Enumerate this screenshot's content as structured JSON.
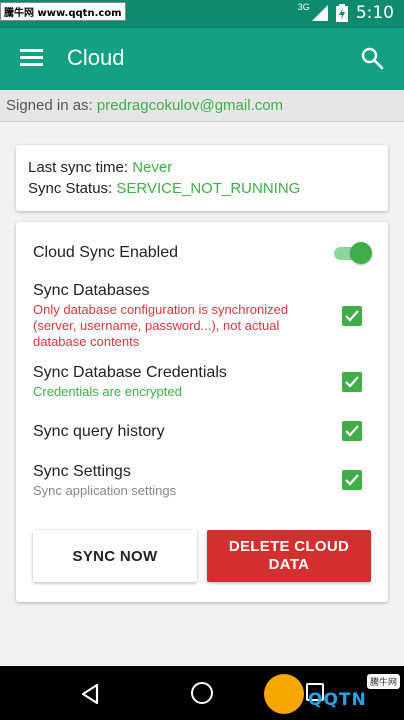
{
  "status_bar": {
    "watermark": "騰牛网 www.qqtn.com",
    "network": "3G",
    "time": "5:10"
  },
  "app_bar": {
    "title": "Cloud"
  },
  "account": {
    "label": "Signed in as:",
    "email": "predragcokulov@gmail.com"
  },
  "sync_info": {
    "last_sync_label": "Last sync time:",
    "last_sync_value": "Never",
    "status_label": "Sync Status:",
    "status_value": "SERVICE_NOT_RUNNING"
  },
  "settings": {
    "cloud_sync": {
      "title": "Cloud Sync Enabled",
      "enabled": true
    },
    "sync_databases": {
      "title": "Sync Databases",
      "subtitle": "Only database configuration is synchronized (server, username, password...), not actual database contents",
      "checked": true
    },
    "sync_credentials": {
      "title": "Sync Database Credentials",
      "subtitle": "Credentials are encrypted",
      "checked": true
    },
    "sync_query_history": {
      "title": "Sync query history",
      "checked": true
    },
    "sync_settings": {
      "title": "Sync Settings",
      "subtitle": "Sync application settings",
      "checked": true
    }
  },
  "buttons": {
    "sync_now": "SYNC NOW",
    "delete_cloud_data": "DELETE CLOUD DATA"
  },
  "nav_watermark": {
    "brand": "QQTN",
    "tag": "騰牛网"
  },
  "colors": {
    "primary": "#12a182",
    "primary_dark": "#0e8b6f",
    "accent": "#3fae49",
    "danger": "#d32f2f"
  }
}
